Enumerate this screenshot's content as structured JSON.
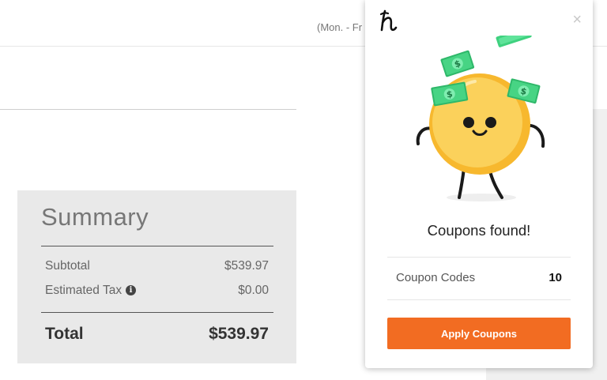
{
  "page": {
    "hours_text": "(Mon. - Fr"
  },
  "summary": {
    "title": "Summary",
    "subtotal_label": "Subtotal",
    "subtotal_value": "$539.97",
    "tax_label": "Estimated Tax",
    "tax_value": "$0.00",
    "total_label": "Total",
    "total_value": "$539.97"
  },
  "popup": {
    "close_label": "×",
    "headline": "Coupons found!",
    "codes_label": "Coupon Codes",
    "codes_count": "10",
    "apply_label": "Apply Coupons",
    "icons": [
      "honey-logo-icon",
      "close-icon",
      "info-icon"
    ],
    "colors": {
      "accent": "#f26c22",
      "coin": "#f9c33b",
      "cash": "#3fd17f"
    }
  }
}
